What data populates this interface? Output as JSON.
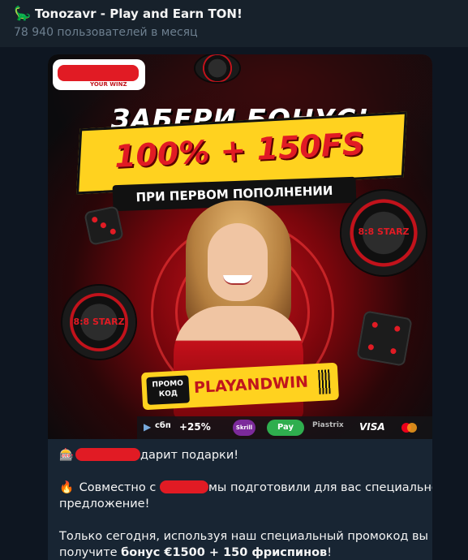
{
  "header": {
    "icon": "dinosaur-icon",
    "title": "Tonozavr - Play and Earn TON!",
    "subtitle": "78 940 пользователей в месяц"
  },
  "banner": {
    "logo_text": "YOUR WINZ",
    "headline": "ЗАБЕРИ БОНУС!",
    "bonus": "100% + 150FS",
    "sub": "ПРИ ПЕРВОМ ПОПОЛНЕНИИ",
    "chip_label": "8:8 STARZ",
    "promo_label_line1": "ПРОМО",
    "promo_label_line2": "КОД",
    "promo_code": "PLAYANDWIN",
    "payments": {
      "sbp": "сбп",
      "sbp_bonus": "+25%",
      "skrill": "Skrill",
      "gpay": "Pay",
      "piastrix": "Piastrix",
      "visa": "VISA"
    },
    "colors": {
      "accent_red": "#e11b24",
      "accent_yellow": "#ffd21f"
    }
  },
  "message": {
    "line1_emoji": "slot-machine-icon",
    "line1_text": "дарит подарки!",
    "p2_emoji": "fire-icon",
    "p2_before": "Совместно с",
    "p2_after": "мы подготовили для вас специальное",
    "p2_line2": "предложение!",
    "p3_line1": "Только сегодня, используя наш специальный промокод вы",
    "p3_line2_prefix": "получите ",
    "p3_line2_bold": "бонус €1500 + 150 фриспинов",
    "p3_line2_suffix": "!"
  }
}
